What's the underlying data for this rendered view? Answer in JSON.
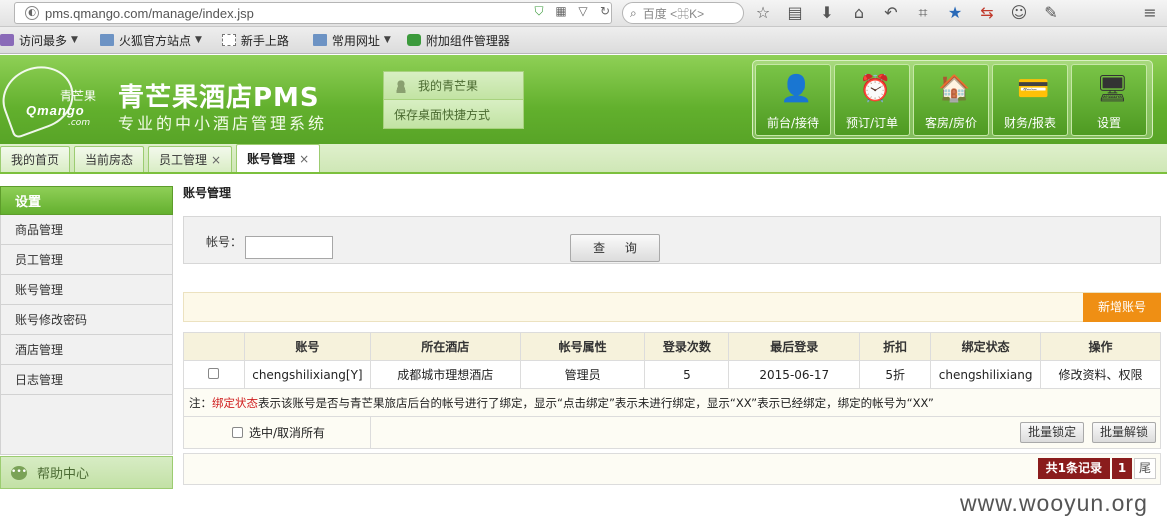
{
  "browser": {
    "url": "pms.qmango.com/manage/index.jsp",
    "search_placeholder": "百度 <⌘K>",
    "bookmarks": [
      {
        "label": "访问最多",
        "has_menu": true
      },
      {
        "label": "火狐官方站点",
        "has_menu": true
      },
      {
        "label": "新手上路",
        "has_menu": false
      },
      {
        "label": "常用网址",
        "has_menu": true
      },
      {
        "label": "附加组件管理器",
        "has_menu": false
      }
    ]
  },
  "header": {
    "logo_cn": "青芒果",
    "logo_en": "Qmango",
    "logo_com": ".com",
    "title": "青芒果酒店PMS",
    "subtitle": "专业的中小酒店管理系统",
    "quick_links": [
      "我的青芒果",
      "保存桌面快捷方式"
    ],
    "modules": [
      {
        "label": "前台/接待",
        "icon": "reception-icon"
      },
      {
        "label": "预订/订单",
        "icon": "alarm-clock-icon"
      },
      {
        "label": "客房/房价",
        "icon": "house-icon"
      },
      {
        "label": "财务/报表",
        "icon": "finance-icon"
      },
      {
        "label": "设置",
        "icon": "monitor-icon"
      }
    ]
  },
  "tabs": [
    {
      "label": "我的首页",
      "closable": false
    },
    {
      "label": "当前房态",
      "closable": false
    },
    {
      "label": "员工管理",
      "closable": true
    },
    {
      "label": "账号管理",
      "closable": true,
      "active": true
    }
  ],
  "sidebar": {
    "heading": "设置",
    "items": [
      "商品管理",
      "员工管理",
      "账号管理",
      "账号修改密码",
      "酒店管理",
      "日志管理"
    ],
    "help": "帮助中心"
  },
  "main": {
    "title": "账号管理",
    "query_label": "帐号：",
    "query_value": "",
    "query_button": "查 询",
    "add_button": "新增账号",
    "columns": [
      "",
      "账号",
      "所在酒店",
      "帐号属性",
      "登录次数",
      "最后登录",
      "折扣",
      "绑定状态",
      "操作"
    ],
    "rows": [
      [
        "",
        "chengshilixiang[Y]",
        "成都城市理想酒店",
        "管理员",
        "5",
        "2015-06-17",
        "5折",
        "chengshilixiang",
        "修改资料、权限"
      ]
    ],
    "note_prefix": "注：",
    "note_highlight": "绑定状态",
    "note_text": "表示该账号是否与青芒果旅店后台的帐号进行了绑定，显示“点击绑定”表示未进行绑定，显示“XX”表示已经绑定，绑定的帐号为“XX”",
    "select_all": "选中/取消所有",
    "batch_lock": "批量锁定",
    "batch_unlock": "批量解锁",
    "pager_total": "共1条记录",
    "pager_page": "1",
    "pager_last": "尾"
  },
  "watermark": "www.wooyun.org"
}
